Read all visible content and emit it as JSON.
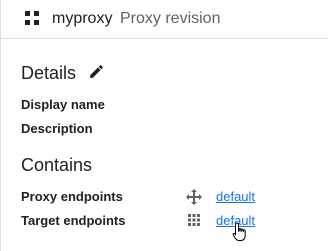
{
  "header": {
    "apps_icon": "apps-grid-icon",
    "proxy_name": "myproxy",
    "subtitle": "Proxy revision"
  },
  "details": {
    "title": "Details",
    "edit_icon": "edit-pencil-icon",
    "display_name_label": "Display name",
    "description_label": "Description"
  },
  "contains": {
    "title": "Contains",
    "proxy_endpoints": {
      "label": "Proxy endpoints",
      "icon": "move-arrows-icon",
      "link": "default"
    },
    "target_endpoints": {
      "label": "Target endpoints",
      "icon": "grid-dots-icon",
      "link": "default"
    }
  },
  "colors": {
    "link": "#1a73e8",
    "text": "#202124",
    "muted": "#5f6368",
    "divider": "#e0e0e0"
  }
}
